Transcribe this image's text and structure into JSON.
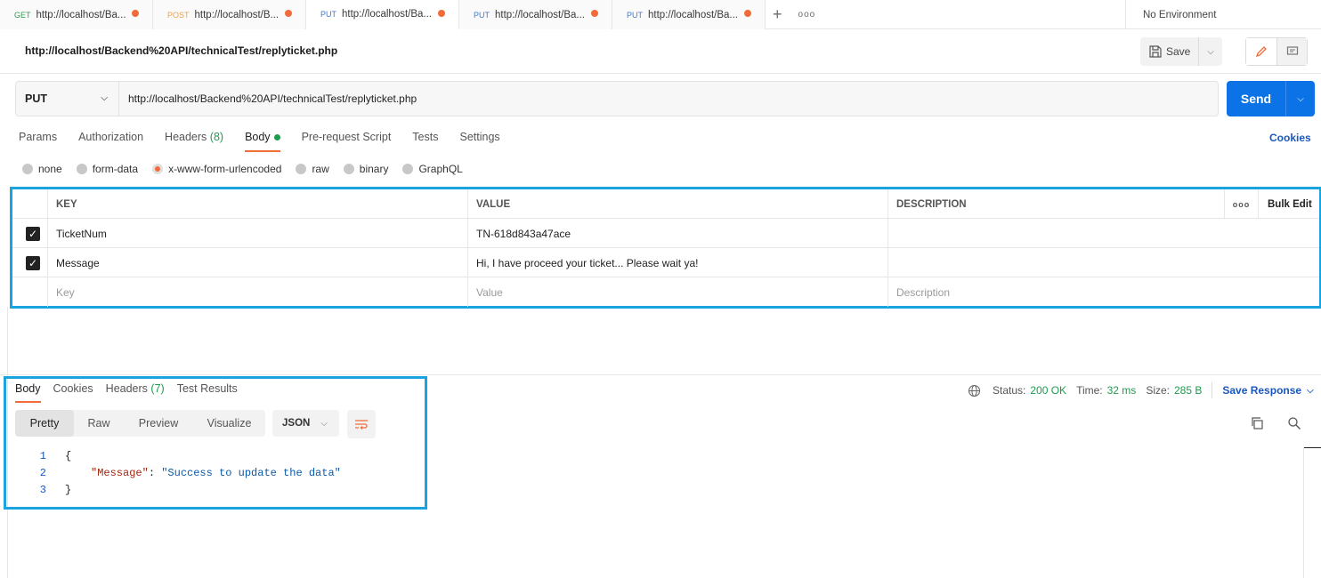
{
  "tabs": [
    {
      "method": "GET",
      "method_color": "#2e9c4e",
      "url": "http://localhost/Ba...",
      "active": false
    },
    {
      "method": "POST",
      "method_color": "#f0a24b",
      "url": "http://localhost/B...",
      "active": false
    },
    {
      "method": "PUT",
      "method_color": "#3a7bd5",
      "url": "http://localhost/Ba...",
      "active": true
    },
    {
      "method": "PUT",
      "method_color": "#3a7bd5",
      "url": "http://localhost/Ba...",
      "active": false
    },
    {
      "method": "PUT",
      "method_color": "#3a7bd5",
      "url": "http://localhost/Ba...",
      "active": false
    }
  ],
  "tab_actions": {
    "add": "+",
    "more": "ooo"
  },
  "environment": "No Environment",
  "request": {
    "title": "http://localhost/Backend%20API/technicalTest/replyticket.php",
    "save_label": "Save",
    "method": "PUT",
    "url": "http://localhost/Backend%20API/technicalTest/replyticket.php",
    "send_label": "Send"
  },
  "req_tabs": {
    "params": "Params",
    "authorization": "Authorization",
    "headers": "Headers",
    "headers_count": "(8)",
    "body": "Body",
    "prerequest": "Pre-request Script",
    "tests": "Tests",
    "settings": "Settings",
    "cookies": "Cookies"
  },
  "body_types": {
    "none": "none",
    "form_data": "form-data",
    "urlencoded": "x-www-form-urlencoded",
    "raw": "raw",
    "binary": "binary",
    "graphql": "GraphQL"
  },
  "params_table": {
    "headers": {
      "key": "KEY",
      "value": "VALUE",
      "description": "DESCRIPTION",
      "more": "ooo",
      "bulk_edit": "Bulk Edit"
    },
    "rows": [
      {
        "key": "TicketNum",
        "value": "TN-618d843a47ace",
        "description": ""
      },
      {
        "key": "Message",
        "value": "Hi, I have proceed your ticket... Please wait ya!",
        "description": ""
      }
    ],
    "placeholders": {
      "key": "Key",
      "value": "Value",
      "description": "Description"
    }
  },
  "response": {
    "tabs": {
      "body": "Body",
      "cookies": "Cookies",
      "headers": "Headers",
      "headers_count": "(7)",
      "tests": "Test Results"
    },
    "views": {
      "pretty": "Pretty",
      "raw": "Raw",
      "preview": "Preview",
      "visualize": "Visualize"
    },
    "format": "JSON",
    "status_label": "Status:",
    "status_value": "200 OK",
    "time_label": "Time:",
    "time_value": "32 ms",
    "size_label": "Size:",
    "size_value": "285 B",
    "save_response": "Save Response",
    "lines": {
      "n1": "1",
      "n2": "2",
      "n3": "3",
      "open": "{",
      "key": "\"Message\"",
      "colon": ": ",
      "value": "\"Success to update the data\"",
      "close": "}"
    }
  },
  "colors": {
    "accent": "#f26b3a",
    "send": "#0b73e5",
    "highlight": "#1aa3de",
    "success": "#1e9b4e"
  }
}
